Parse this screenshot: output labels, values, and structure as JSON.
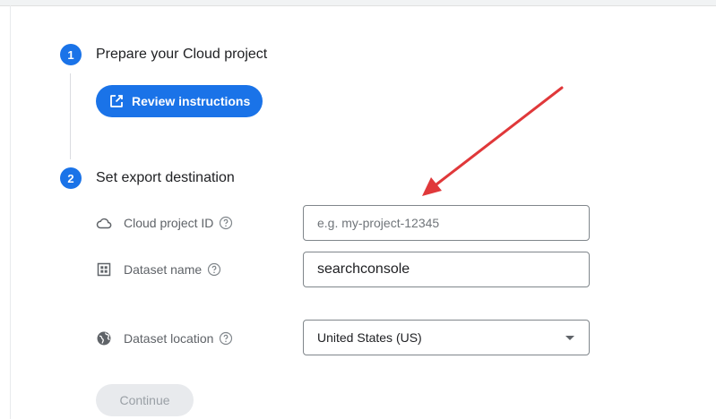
{
  "steps": [
    {
      "number": "1",
      "title": "Prepare your Cloud project"
    },
    {
      "number": "2",
      "title": "Set export destination"
    }
  ],
  "review_button": {
    "label": "Review instructions",
    "icon": "open-in-new-icon"
  },
  "fields": {
    "cloud_project_id": {
      "label": "Cloud project ID",
      "icon": "cloud-icon",
      "value": "",
      "placeholder": "e.g. my-project-12345"
    },
    "dataset_name": {
      "label": "Dataset name",
      "icon": "table-grid-icon",
      "value": "searchconsole",
      "placeholder": ""
    },
    "dataset_location": {
      "label": "Dataset location",
      "icon": "globe-icon",
      "selected": "United States (US)"
    }
  },
  "continue_button": {
    "label": "Continue"
  },
  "colors": {
    "primary": "#1a73e8",
    "annotation_arrow": "#e0383a",
    "disabled_bg": "#e8eaed"
  }
}
